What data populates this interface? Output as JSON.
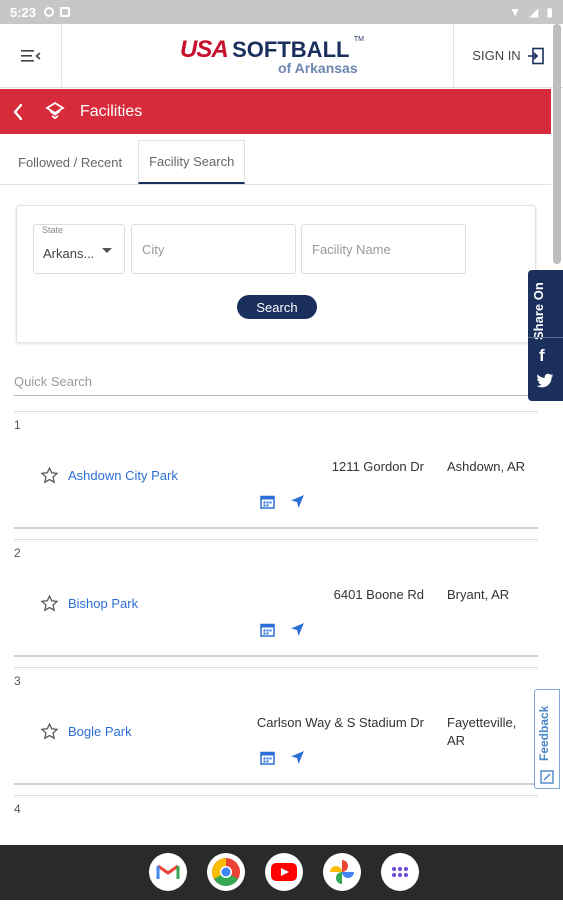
{
  "status_bar": {
    "time": "5:23"
  },
  "header": {
    "logo_usa": "USA",
    "logo_softball": "SOFTBALL",
    "logo_tm": "TM",
    "logo_sub": "of Arkansas",
    "signin_label": "SIGN IN"
  },
  "page": {
    "title": "Facilities"
  },
  "tabs": [
    {
      "label": "Followed / Recent"
    },
    {
      "label": "Facility Search"
    }
  ],
  "search": {
    "state_label": "State",
    "state_value": "Arkans...",
    "city_placeholder": "City",
    "facility_placeholder": "Facility Name",
    "search_button": "Search"
  },
  "quick_search": {
    "placeholder": "Quick Search"
  },
  "results": [
    {
      "num": "1",
      "name": "Ashdown City Park",
      "address": "1211 Gordon Dr",
      "city": "Ashdown, AR"
    },
    {
      "num": "2",
      "name": "Bishop Park",
      "address": "6401 Boone Rd",
      "city": "Bryant, AR"
    },
    {
      "num": "3",
      "name": "Bogle Park",
      "address": "Carlson Way & S Stadium Dr",
      "city": "Fayetteville, AR"
    },
    {
      "num": "4"
    }
  ],
  "share": {
    "label": "Share On"
  },
  "feedback": {
    "label": "Feedback"
  },
  "colors": {
    "brand_red": "#d72a3a",
    "brand_navy": "#1b2f5c",
    "link_blue": "#2b6fd6"
  },
  "dock_apps": [
    "gmail-icon",
    "chrome-icon",
    "youtube-icon",
    "photos-icon",
    "apps-icon"
  ]
}
